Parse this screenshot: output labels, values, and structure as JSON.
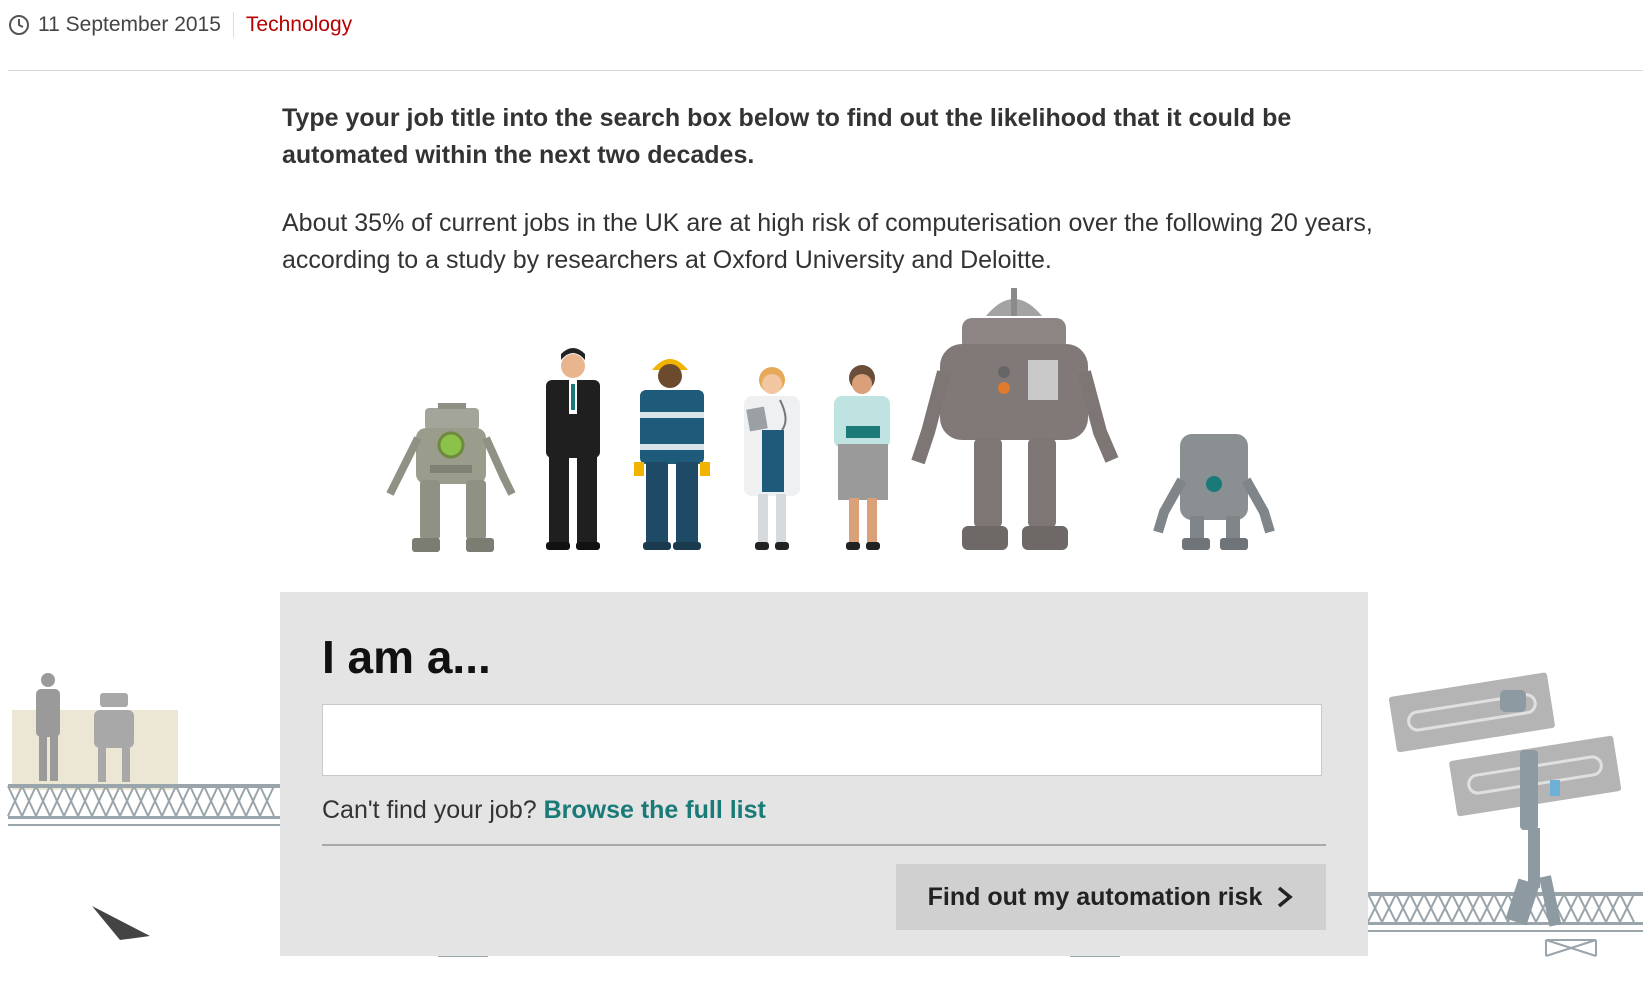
{
  "meta": {
    "date": "11 September 2015",
    "category": "Technology",
    "icon": "clock-icon"
  },
  "intro": "Type your job title into the search box below to find out the likelihood that it could be automated within the next two decades.",
  "body": "About 35% of current jobs in the UK are at high risk of computerisation over the following 20 years, according to a study by researchers at Oxford University and Deloitte.",
  "form": {
    "heading": "I am a...",
    "input_value": "",
    "browse_prefix": "Can't find your job?",
    "browse_link": "Browse the full list",
    "submit_label": "Find out my automation risk",
    "submit_icon": "chevron-right-icon"
  },
  "colors": {
    "accent": "#1a7a78",
    "category": "#b80000",
    "panel": "#e4e4e4",
    "button": "#d0d0d0"
  }
}
